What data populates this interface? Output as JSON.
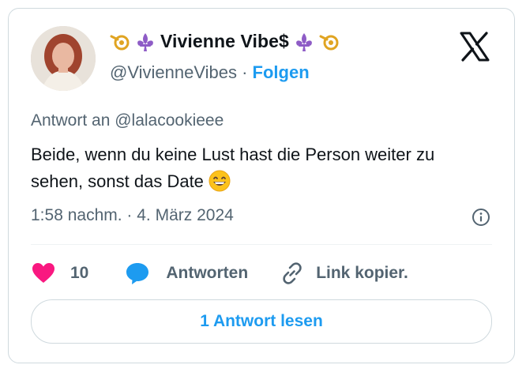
{
  "author": {
    "display_name": "Vivienne Vibe$",
    "handle": "@VivienneVibes",
    "separator": "·",
    "follow_label": "Folgen"
  },
  "tweet": {
    "reply_to": "Antwort an @lalacookieee",
    "text": "Beide, wenn du keine Lust hast die Person weiter zu sehen, sonst das Date",
    "emoji": "grinning-face-with-smiling-eyes",
    "timestamp": "1:58 nachm. · 4. März 2024"
  },
  "actions": {
    "like_count": "10",
    "reply_label": "Antworten",
    "copy_link_label": "Link kopier."
  },
  "read_replies_label": "1 Antwort lesen",
  "colors": {
    "accent": "#1d9bf0",
    "like": "#f91880",
    "muted": "#536471",
    "text": "#0f1419",
    "border": "#cfd9de"
  },
  "icons": [
    "post-horn-icon",
    "fleur-de-lis-icon",
    "x-logo-icon",
    "info-icon",
    "heart-icon",
    "speech-bubble-icon",
    "link-icon"
  ]
}
